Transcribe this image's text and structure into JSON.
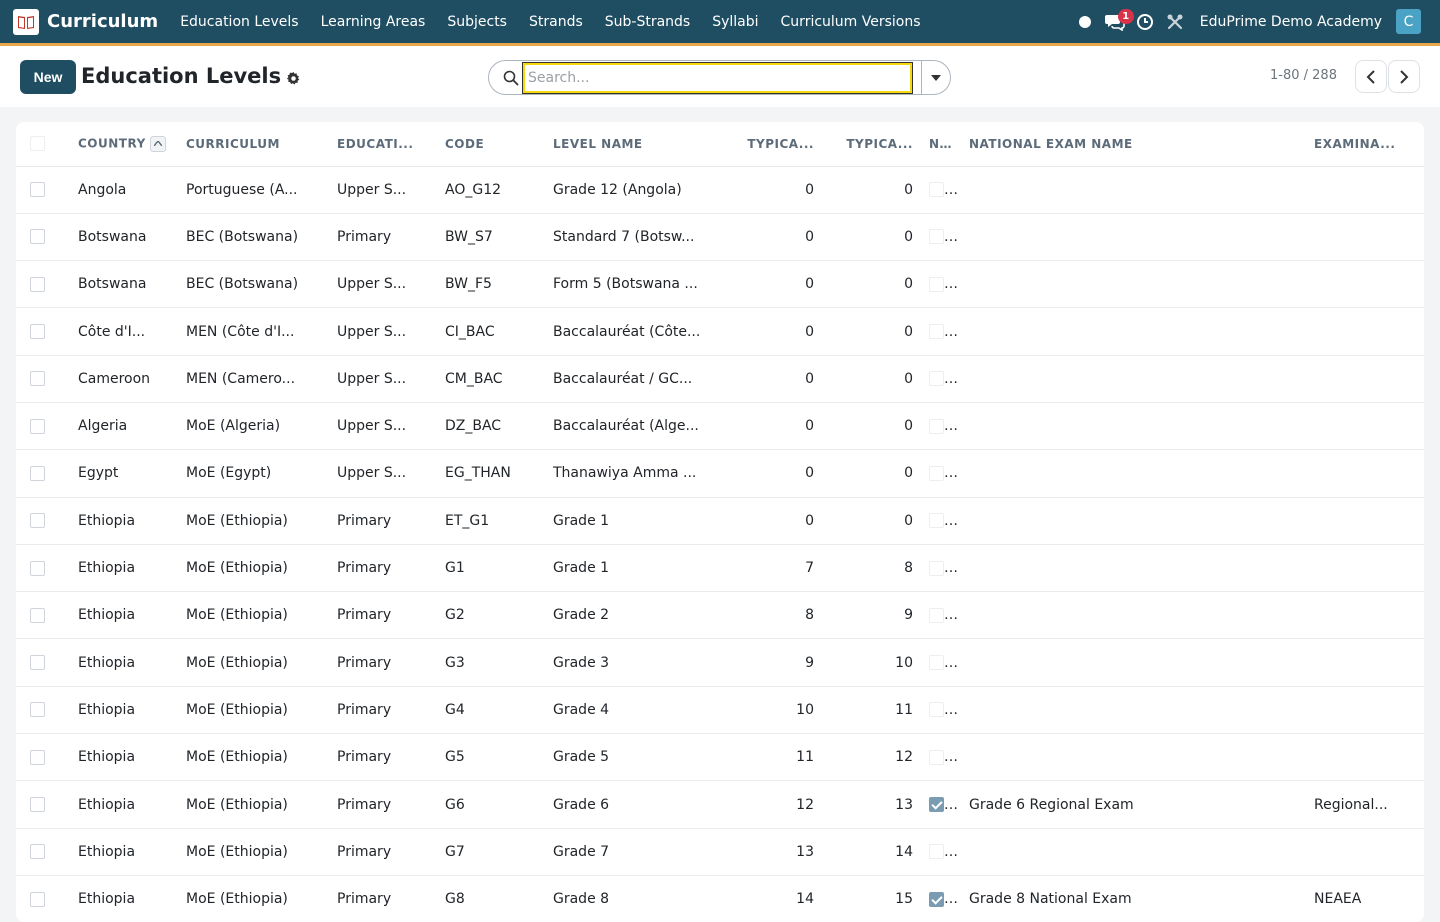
{
  "nav": {
    "app_name": "Curriculum",
    "menu": [
      "Education Levels",
      "Learning Areas",
      "Subjects",
      "Strands",
      "Sub-Strands",
      "Syllabi",
      "Curriculum Versions"
    ],
    "message_count": "1",
    "company": "EduPrime Demo Academy",
    "avatar_letter": "C"
  },
  "control": {
    "new_label": "New",
    "title": "Education Levels",
    "search_placeholder": "Search...",
    "pager": "1-80 / 288"
  },
  "table": {
    "headers": [
      "COUNTRY",
      "CURRICULUM",
      "EDUCATI...",
      "CODE",
      "LEVEL NAME",
      "TYPICA...",
      "TYPICA...",
      "N...",
      "NATIONAL EXAM NAME",
      "EXAMINA..."
    ],
    "rows": [
      {
        "country": "Angola",
        "curriculum": "Portuguese (A...",
        "education": "Upper S...",
        "code": "AO_G12",
        "level": "Grade 12 (Angola)",
        "t1": "0",
        "t2": "0",
        "exam_checked": false,
        "exam_name": "",
        "examiner": ""
      },
      {
        "country": "Botswana",
        "curriculum": "BEC (Botswana)",
        "education": "Primary",
        "code": "BW_S7",
        "level": "Standard 7 (Botsw...",
        "t1": "0",
        "t2": "0",
        "exam_checked": false,
        "exam_name": "",
        "examiner": ""
      },
      {
        "country": "Botswana",
        "curriculum": "BEC (Botswana)",
        "education": "Upper S...",
        "code": "BW_F5",
        "level": "Form 5 (Botswana ...",
        "t1": "0",
        "t2": "0",
        "exam_checked": false,
        "exam_name": "",
        "examiner": ""
      },
      {
        "country": "Côte d'I...",
        "curriculum": "MEN (Côte d'I...",
        "education": "Upper S...",
        "code": "CI_BAC",
        "level": "Baccalauréat (Côte...",
        "t1": "0",
        "t2": "0",
        "exam_checked": false,
        "exam_name": "",
        "examiner": ""
      },
      {
        "country": "Cameroon",
        "curriculum": "MEN (Camero...",
        "education": "Upper S...",
        "code": "CM_BAC",
        "level": "Baccalauréat / GC...",
        "t1": "0",
        "t2": "0",
        "exam_checked": false,
        "exam_name": "",
        "examiner": ""
      },
      {
        "country": "Algeria",
        "curriculum": "MoE (Algeria)",
        "education": "Upper S...",
        "code": "DZ_BAC",
        "level": "Baccalauréat (Alge...",
        "t1": "0",
        "t2": "0",
        "exam_checked": false,
        "exam_name": "",
        "examiner": ""
      },
      {
        "country": "Egypt",
        "curriculum": "MoE (Egypt)",
        "education": "Upper S...",
        "code": "EG_THAN",
        "level": "Thanawiya Amma ...",
        "t1": "0",
        "t2": "0",
        "exam_checked": false,
        "exam_name": "",
        "examiner": ""
      },
      {
        "country": "Ethiopia",
        "curriculum": "MoE (Ethiopia)",
        "education": "Primary",
        "code": "ET_G1",
        "level": "Grade 1",
        "t1": "0",
        "t2": "0",
        "exam_checked": false,
        "exam_name": "",
        "examiner": ""
      },
      {
        "country": "Ethiopia",
        "curriculum": "MoE (Ethiopia)",
        "education": "Primary",
        "code": "G1",
        "level": "Grade 1",
        "t1": "7",
        "t2": "8",
        "exam_checked": false,
        "exam_name": "",
        "examiner": ""
      },
      {
        "country": "Ethiopia",
        "curriculum": "MoE (Ethiopia)",
        "education": "Primary",
        "code": "G2",
        "level": "Grade 2",
        "t1": "8",
        "t2": "9",
        "exam_checked": false,
        "exam_name": "",
        "examiner": ""
      },
      {
        "country": "Ethiopia",
        "curriculum": "MoE (Ethiopia)",
        "education": "Primary",
        "code": "G3",
        "level": "Grade 3",
        "t1": "9",
        "t2": "10",
        "exam_checked": false,
        "exam_name": "",
        "examiner": ""
      },
      {
        "country": "Ethiopia",
        "curriculum": "MoE (Ethiopia)",
        "education": "Primary",
        "code": "G4",
        "level": "Grade 4",
        "t1": "10",
        "t2": "11",
        "exam_checked": false,
        "exam_name": "",
        "examiner": ""
      },
      {
        "country": "Ethiopia",
        "curriculum": "MoE (Ethiopia)",
        "education": "Primary",
        "code": "G5",
        "level": "Grade 5",
        "t1": "11",
        "t2": "12",
        "exam_checked": false,
        "exam_name": "",
        "examiner": ""
      },
      {
        "country": "Ethiopia",
        "curriculum": "MoE (Ethiopia)",
        "education": "Primary",
        "code": "G6",
        "level": "Grade 6",
        "t1": "12",
        "t2": "13",
        "exam_checked": true,
        "exam_name": "Grade 6 Regional Exam",
        "examiner": "Regional..."
      },
      {
        "country": "Ethiopia",
        "curriculum": "MoE (Ethiopia)",
        "education": "Primary",
        "code": "G7",
        "level": "Grade 7",
        "t1": "13",
        "t2": "14",
        "exam_checked": false,
        "exam_name": "",
        "examiner": ""
      },
      {
        "country": "Ethiopia",
        "curriculum": "MoE (Ethiopia)",
        "education": "Primary",
        "code": "G8",
        "level": "Grade 8",
        "t1": "14",
        "t2": "15",
        "exam_checked": true,
        "exam_name": "Grade 8 National Exam",
        "examiner": "NEAEA"
      }
    ]
  },
  "colors": {
    "nav_bg": "#1f4e62",
    "nav_border": "#e8a64a",
    "accent": "#1f4e62",
    "badge": "#d9334a"
  }
}
